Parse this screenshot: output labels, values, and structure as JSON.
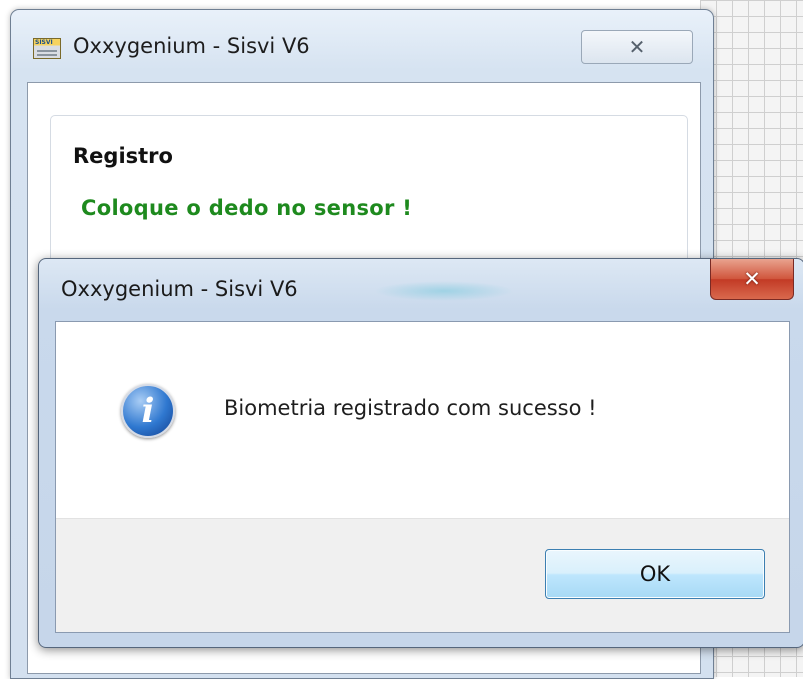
{
  "back_window": {
    "title": "Oxxygenium - Sisvi V6",
    "close_glyph": "✕",
    "app_icon_label": "SISVI",
    "group": {
      "title": "Registro",
      "message": "Coloque o dedo no sensor !",
      "message_color": "#1e8a1e"
    }
  },
  "dialog": {
    "title": "Oxxygenium - Sisvi V6",
    "close_glyph": "✕",
    "icon": "information-icon",
    "icon_glyph": "i",
    "message": "Biometria registrado com sucesso !",
    "ok_label": "OK",
    "close_color": "#c23a25"
  }
}
